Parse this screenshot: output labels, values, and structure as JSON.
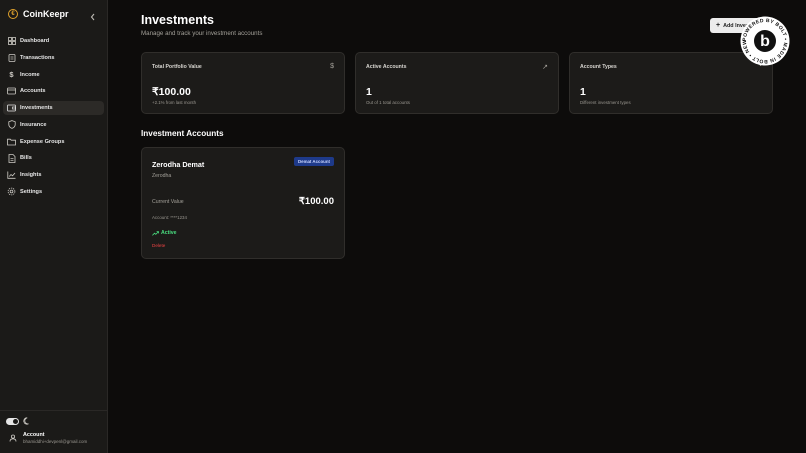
{
  "app": {
    "name": "CoinKeepr",
    "logo_glyph": "€"
  },
  "sidebar": {
    "items": [
      {
        "label": "Dashboard",
        "icon": "dashboard-icon",
        "active": false
      },
      {
        "label": "Transactions",
        "icon": "receipt-icon",
        "active": false
      },
      {
        "label": "Income",
        "icon": "dollar-icon",
        "active": false
      },
      {
        "label": "Accounts",
        "icon": "credit-card-icon",
        "active": false
      },
      {
        "label": "Investments",
        "icon": "wallet-icon",
        "active": true
      },
      {
        "label": "Insurance",
        "icon": "shield-icon",
        "active": false
      },
      {
        "label": "Expense Groups",
        "icon": "folder-icon",
        "active": false
      },
      {
        "label": "Bills",
        "icon": "file-text-icon",
        "active": false
      },
      {
        "label": "Insights",
        "icon": "line-chart-icon",
        "active": false
      },
      {
        "label": "Settings",
        "icon": "gear-icon",
        "active": false
      }
    ]
  },
  "footer": {
    "account_label": "Account",
    "email": "bhamiddhi+devpenl@gmail.com"
  },
  "header": {
    "title": "Investments",
    "subtitle": "Manage and track your investment accounts",
    "add_button": "Add Investment"
  },
  "stats": [
    {
      "title": "Total Portfolio Value",
      "icon_glyph": "$",
      "value": "₹100.00",
      "note": "+2.1% from last month"
    },
    {
      "title": "Active Accounts",
      "icon_glyph": "↗",
      "value": "1",
      "note": "Out of 1 total accounts"
    },
    {
      "title": "Account Types",
      "icon_glyph": "◔",
      "value": "1",
      "note": "Different investment types"
    }
  ],
  "section": {
    "title": "Investment Accounts"
  },
  "accounts": [
    {
      "name": "Zerodha Demat",
      "badge": "Demat Account",
      "provider": "Zerodha",
      "current_value_label": "Current Value",
      "current_value": "₹100.00",
      "account_number": "Account: ****1234",
      "status": "Active",
      "delete_label": "Delete"
    }
  ],
  "badge": {
    "text": "POWERED BY BOLT • MADE IN BOLT • NEW •",
    "letter": "b"
  },
  "colors": {
    "accent": "#e0a22c",
    "success": "#4ade80",
    "danger": "#ef4444",
    "badge_bg": "#1e3a8a"
  }
}
